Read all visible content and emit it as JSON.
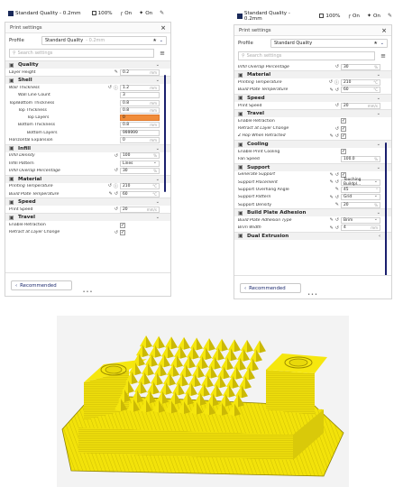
{
  "toolbar": {
    "profile_label": "Standard Quality - 0.2mm",
    "infill_pct": "100%",
    "support_state": "On",
    "adhesion_state": "On"
  },
  "panel": {
    "title": "Print settings",
    "profile_label": "Profile",
    "profile_value": "Standard Quality",
    "profile_sub": "- 0.2mm",
    "search_placeholder": "Search settings",
    "recommended_label": "Recommended",
    "accent_color": "#1a1f6e",
    "highlight_color": "#f08c3a"
  },
  "left_list": [
    {
      "type": "category",
      "label": "Quality",
      "icon": "quality-icon"
    },
    {
      "type": "setting",
      "label": "Layer Height",
      "value": "0.2",
      "unit": "mm",
      "icons": "edit"
    },
    {
      "type": "category",
      "label": "Shell",
      "icon": "shell-icon"
    },
    {
      "type": "setting",
      "label": "Wall Thickness",
      "value": "1.2",
      "unit": "mm",
      "italic": true,
      "icons": "reset-info"
    },
    {
      "type": "setting",
      "label": "Wall Line Count",
      "value": "3",
      "indent": 1
    },
    {
      "type": "setting",
      "label": "Top/Bottom Thickness",
      "value": "0.8",
      "unit": "mm"
    },
    {
      "type": "setting",
      "label": "Top Thickness",
      "value": "0.8",
      "unit": "mm",
      "indent": 1
    },
    {
      "type": "setting",
      "label": "Top Layers",
      "value": "0",
      "indent": 2,
      "highlight": true
    },
    {
      "type": "setting",
      "label": "Bottom Thickness",
      "value": "0.8",
      "unit": "mm",
      "indent": 1
    },
    {
      "type": "setting",
      "label": "Bottom Layers",
      "value": "999999",
      "indent": 2
    },
    {
      "type": "setting",
      "label": "Horizontal Expansion",
      "value": "0",
      "unit": "mm"
    },
    {
      "type": "category",
      "label": "Infill",
      "icon": "infill-icon"
    },
    {
      "type": "setting",
      "label": "Infill Density",
      "value": "100",
      "unit": "%",
      "italic": true,
      "icons": "reset"
    },
    {
      "type": "setting",
      "label": "Infill Pattern",
      "value": "Lines",
      "dropdown": true
    },
    {
      "type": "setting",
      "label": "Infill Overlap Percentage",
      "value": "30",
      "unit": "%",
      "italic": true,
      "icons": "reset"
    },
    {
      "type": "category",
      "label": "Material",
      "icon": "material-icon"
    },
    {
      "type": "setting",
      "label": "Printing Temperature",
      "value": "210",
      "unit": "°C",
      "italic": true,
      "icons": "reset-info"
    },
    {
      "type": "setting",
      "label": "Build Plate Temperature",
      "value": "60",
      "unit": "°C",
      "italic": true,
      "icons": "edit-reset"
    },
    {
      "type": "category",
      "label": "Speed",
      "icon": "speed-icon"
    },
    {
      "type": "setting",
      "label": "Print Speed",
      "value": "20",
      "unit": "mm/s",
      "icons": "reset"
    },
    {
      "type": "category",
      "label": "Travel",
      "icon": "travel-icon"
    },
    {
      "type": "setting",
      "label": "Enable Retraction",
      "checkbox": true
    },
    {
      "type": "setting",
      "label": "Retract at Layer Change",
      "checkbox": true,
      "italic": true,
      "icons": "reset"
    }
  ],
  "right_list": [
    {
      "type": "setting",
      "label": "Infill Overlap Percentage",
      "value": "30",
      "unit": "%",
      "italic": true,
      "icons": "reset"
    },
    {
      "type": "category",
      "label": "Material",
      "icon": "material-icon"
    },
    {
      "type": "setting",
      "label": "Printing Temperature",
      "value": "210",
      "unit": "°C",
      "italic": true,
      "icons": "reset-info"
    },
    {
      "type": "setting",
      "label": "Build Plate Temperature",
      "value": "60",
      "unit": "°C",
      "italic": true,
      "icons": "edit-reset"
    },
    {
      "type": "category",
      "label": "Speed",
      "icon": "speed-icon"
    },
    {
      "type": "setting",
      "label": "Print Speed",
      "value": "20",
      "unit": "mm/s",
      "icons": "reset"
    },
    {
      "type": "category",
      "label": "Travel",
      "icon": "travel-icon"
    },
    {
      "type": "setting",
      "label": "Enable Retraction",
      "checkbox": true
    },
    {
      "type": "setting",
      "label": "Retract at Layer Change",
      "checkbox": true,
      "italic": true,
      "icons": "reset"
    },
    {
      "type": "setting",
      "label": "Z Hop When Retracted",
      "checkbox": true,
      "italic": true,
      "icons": "edit-reset"
    },
    {
      "type": "category",
      "label": "Cooling",
      "icon": "cooling-icon"
    },
    {
      "type": "setting",
      "label": "Enable Print Cooling",
      "checkbox": true
    },
    {
      "type": "setting",
      "label": "Fan Speed",
      "value": "100.0",
      "unit": "%"
    },
    {
      "type": "category",
      "label": "Support",
      "icon": "support-icon"
    },
    {
      "type": "setting",
      "label": "Generate Support",
      "checkbox": true,
      "italic": true,
      "icons": "edit-reset"
    },
    {
      "type": "setting",
      "label": "Support Placement",
      "value": "Touching Buildpl...",
      "dropdown": true,
      "italic": true,
      "icons": "edit-reset"
    },
    {
      "type": "setting",
      "label": "Support Overhang Angle",
      "value": "45",
      "unit": "°",
      "icons": "edit"
    },
    {
      "type": "setting",
      "label": "Support Pattern",
      "value": "Grid",
      "dropdown": true,
      "italic": true,
      "icons": "edit-reset"
    },
    {
      "type": "setting",
      "label": "Support Density",
      "value": "20",
      "unit": "%",
      "icons": "edit"
    },
    {
      "type": "category",
      "label": "Build Plate Adhesion",
      "icon": "adhesion-icon"
    },
    {
      "type": "setting",
      "label": "Build Plate Adhesion Type",
      "value": "Brim",
      "dropdown": true,
      "italic": true,
      "icons": "edit-reset"
    },
    {
      "type": "setting",
      "label": "Brim Width",
      "value": "4",
      "unit": "mm",
      "italic": true,
      "icons": "edit-reset"
    },
    {
      "type": "category",
      "label": "Dual Extrusion",
      "icon": "dual-extrusion-icon",
      "collapsed": true
    }
  ]
}
